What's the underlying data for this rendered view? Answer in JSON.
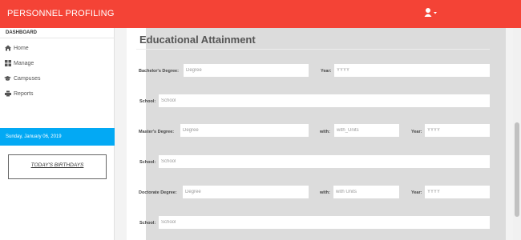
{
  "app": {
    "title": "PERSONNEL PROFILING"
  },
  "sidebar": {
    "header": "DASHBOARD",
    "items": [
      {
        "label": "Home",
        "icon": "home-icon"
      },
      {
        "label": "Manage",
        "icon": "grid-icon"
      },
      {
        "label": "Campuses",
        "icon": "graduation-cap-icon"
      },
      {
        "label": "Reports",
        "icon": "printer-icon"
      }
    ],
    "date": "Sunday, January 06, 2019",
    "birthdays_title": "TODAY'S BIRTHDAYS"
  },
  "form": {
    "title": "Educational Attainment",
    "bachelors": {
      "label": "Bachelor's Degree:",
      "degree_placeholder": "Degree",
      "year_label": "Year:",
      "year_placeholder": "YYYY",
      "school_label": "School:",
      "school_placeholder": "School"
    },
    "masters": {
      "label": "Master's Degree:",
      "degree_placeholder": "Degree",
      "with_label": "with:",
      "units_placeholder": "with_Units",
      "year_label": "Year:",
      "year_placeholder": "YYYY",
      "school_label": "School:",
      "school_placeholder": "School"
    },
    "doctorate": {
      "label": "Doctorate Degree:",
      "degree_placeholder": "Degree",
      "with_label": "with:",
      "units_placeholder": "with Units",
      "year_label": "Year:",
      "year_placeholder": "YYYY",
      "school_label": "School:",
      "school_placeholder": "School"
    }
  }
}
